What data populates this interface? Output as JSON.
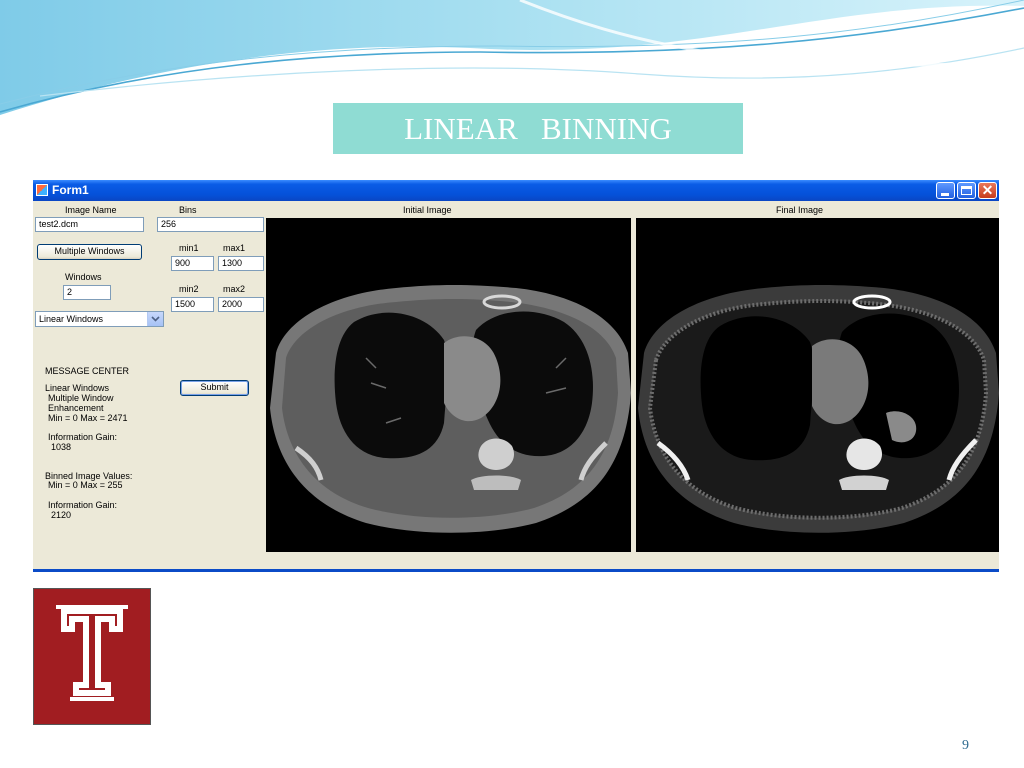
{
  "slide": {
    "title": "LINEAR   BINNING",
    "page_number": "9",
    "colors": {
      "title_bg": "#8fdcd3",
      "accent": "#0b4bc7"
    }
  },
  "window": {
    "title": "Form1",
    "labels": {
      "image_name": "Image Name",
      "bins": "Bins",
      "min1": "min1",
      "max1": "max1",
      "windows": "Windows",
      "min2": "min2",
      "max2": "max2",
      "initial_image": "Initial Image",
      "final_image": "Final Image",
      "message_center": "MESSAGE CENTER"
    },
    "fields": {
      "image_name": "test2.dcm",
      "bins": "256",
      "min1": "900",
      "max1": "1300",
      "windows": "2",
      "min2": "1500",
      "max2": "2000"
    },
    "buttons": {
      "multiple_windows": "Multiple Windows",
      "submit": "Submit"
    },
    "mode_select": {
      "selected": "Linear Windows"
    },
    "messages": {
      "line1": "Linear Windows",
      "line2": "Multiple Window",
      "line3": "Enhancement",
      "line4": "Min = 0 Max = 2471",
      "line5": "Information Gain:",
      "line6": "1038",
      "line7": "Binned Image Values:",
      "line8": "Min = 0 Max = 255",
      "line9": "Information Gain:",
      "line10": "2120"
    }
  }
}
